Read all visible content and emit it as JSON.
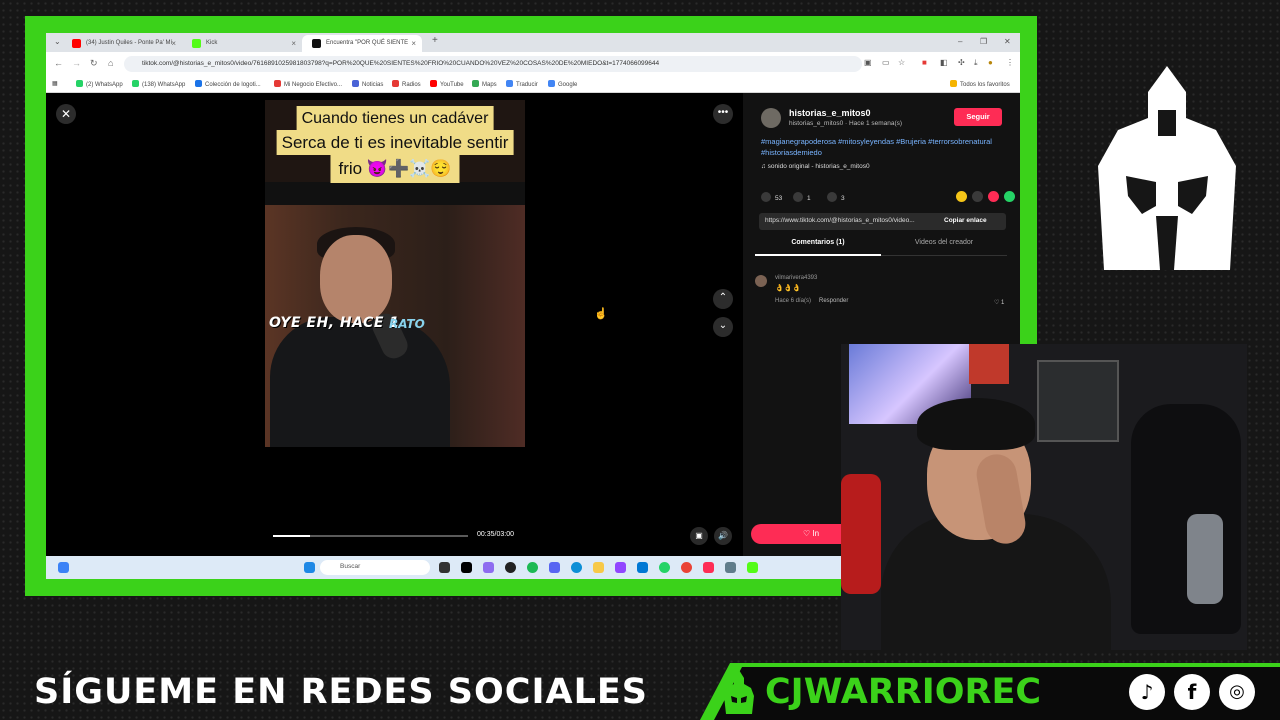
{
  "colors": {
    "green_frame": "#3bd21a",
    "tiktok_red": "#fe2c55",
    "hashtag_blue": "#79b4ff"
  },
  "browser": {
    "tabs": [
      {
        "label": "(34) Justin Quiles - Ponte Pa' Mí",
        "favicon": "youtube-icon",
        "color": "#ff0000"
      },
      {
        "label": "Kick",
        "favicon": "kick-icon",
        "color": "#53fc18"
      },
      {
        "label": "Encuentra \"POR QUÉ SIENTE",
        "favicon": "tiktok-icon",
        "color": "#111111"
      }
    ],
    "new_tab": "+",
    "window_controls": [
      "–",
      "❐",
      "✕"
    ],
    "url": "tiktok.com/@historias_e_mitos0/video/7616891025981803798?q=POR%20QUE%20SIENTES%20FRIO%20CUANDO%20VEZ%20COSAS%20DE%20MIEDO&t=1774066099644",
    "bookmarks": [
      {
        "label": "(2) WhatsApp",
        "color": "#25d366"
      },
      {
        "label": "(138) WhatsApp",
        "color": "#25d366"
      },
      {
        "label": "Colección de logoti...",
        "color": "#1a73e8"
      },
      {
        "label": "Mi Negocio Efectivo...",
        "color": "#e53935"
      },
      {
        "label": "Noticias",
        "color": "#4a63d6"
      },
      {
        "label": "Radios",
        "color": "#e53935"
      },
      {
        "label": "YouTube",
        "color": "#ff0000"
      },
      {
        "label": "Maps",
        "color": "#34a853"
      },
      {
        "label": "Traducir",
        "color": "#4285f4"
      },
      {
        "label": "Google",
        "color": "#4285f4"
      }
    ],
    "all_bookmarks": "Todos los favoritos"
  },
  "video": {
    "caption_lines": [
      "Cuando tienes un cadáver",
      "Serca de ti es inevitable sentir",
      "frio 😈➕☠️😌"
    ],
    "subtitle_main": "OYE EH, HACE 1",
    "subtitle_accent": "RATO",
    "time": "00:35/03:00",
    "progress": 0.19
  },
  "panel": {
    "author": "historias_e_mitos0",
    "author_meta": "historias_e_mitos0 · Hace 1 semana(s)",
    "follow": "Seguir",
    "hashtags": "#magianegrapoderosa #mitosyleyendas #Brujeria #terrorsobrenatural #historiasdemiedo",
    "sound": "♫  sonido original - historias_e_mitos0",
    "likes": "53",
    "comments": "1",
    "saves": "3",
    "link": "https://www.tiktok.com/@historias_e_mitos0/video...",
    "copy_link": "Copiar enlace",
    "tab_comments": "Comentarios (1)",
    "tab_videos": "Videos del creador",
    "comment": {
      "user": "vilmarivera4393",
      "text": "👌👌👌",
      "meta": "Hace 6 día(s)",
      "reply": "Responder",
      "likes": "♡ 1"
    },
    "live_btn": "♡ In"
  },
  "taskbar": {
    "search_placeholder": "Buscar"
  },
  "overlay": {
    "banner_text": "SÍGUEME EN REDES SOCIALES",
    "brand": "CJWARRIOREC",
    "social_icons": [
      "tiktok-icon",
      "facebook-icon",
      "instagram-icon"
    ]
  }
}
